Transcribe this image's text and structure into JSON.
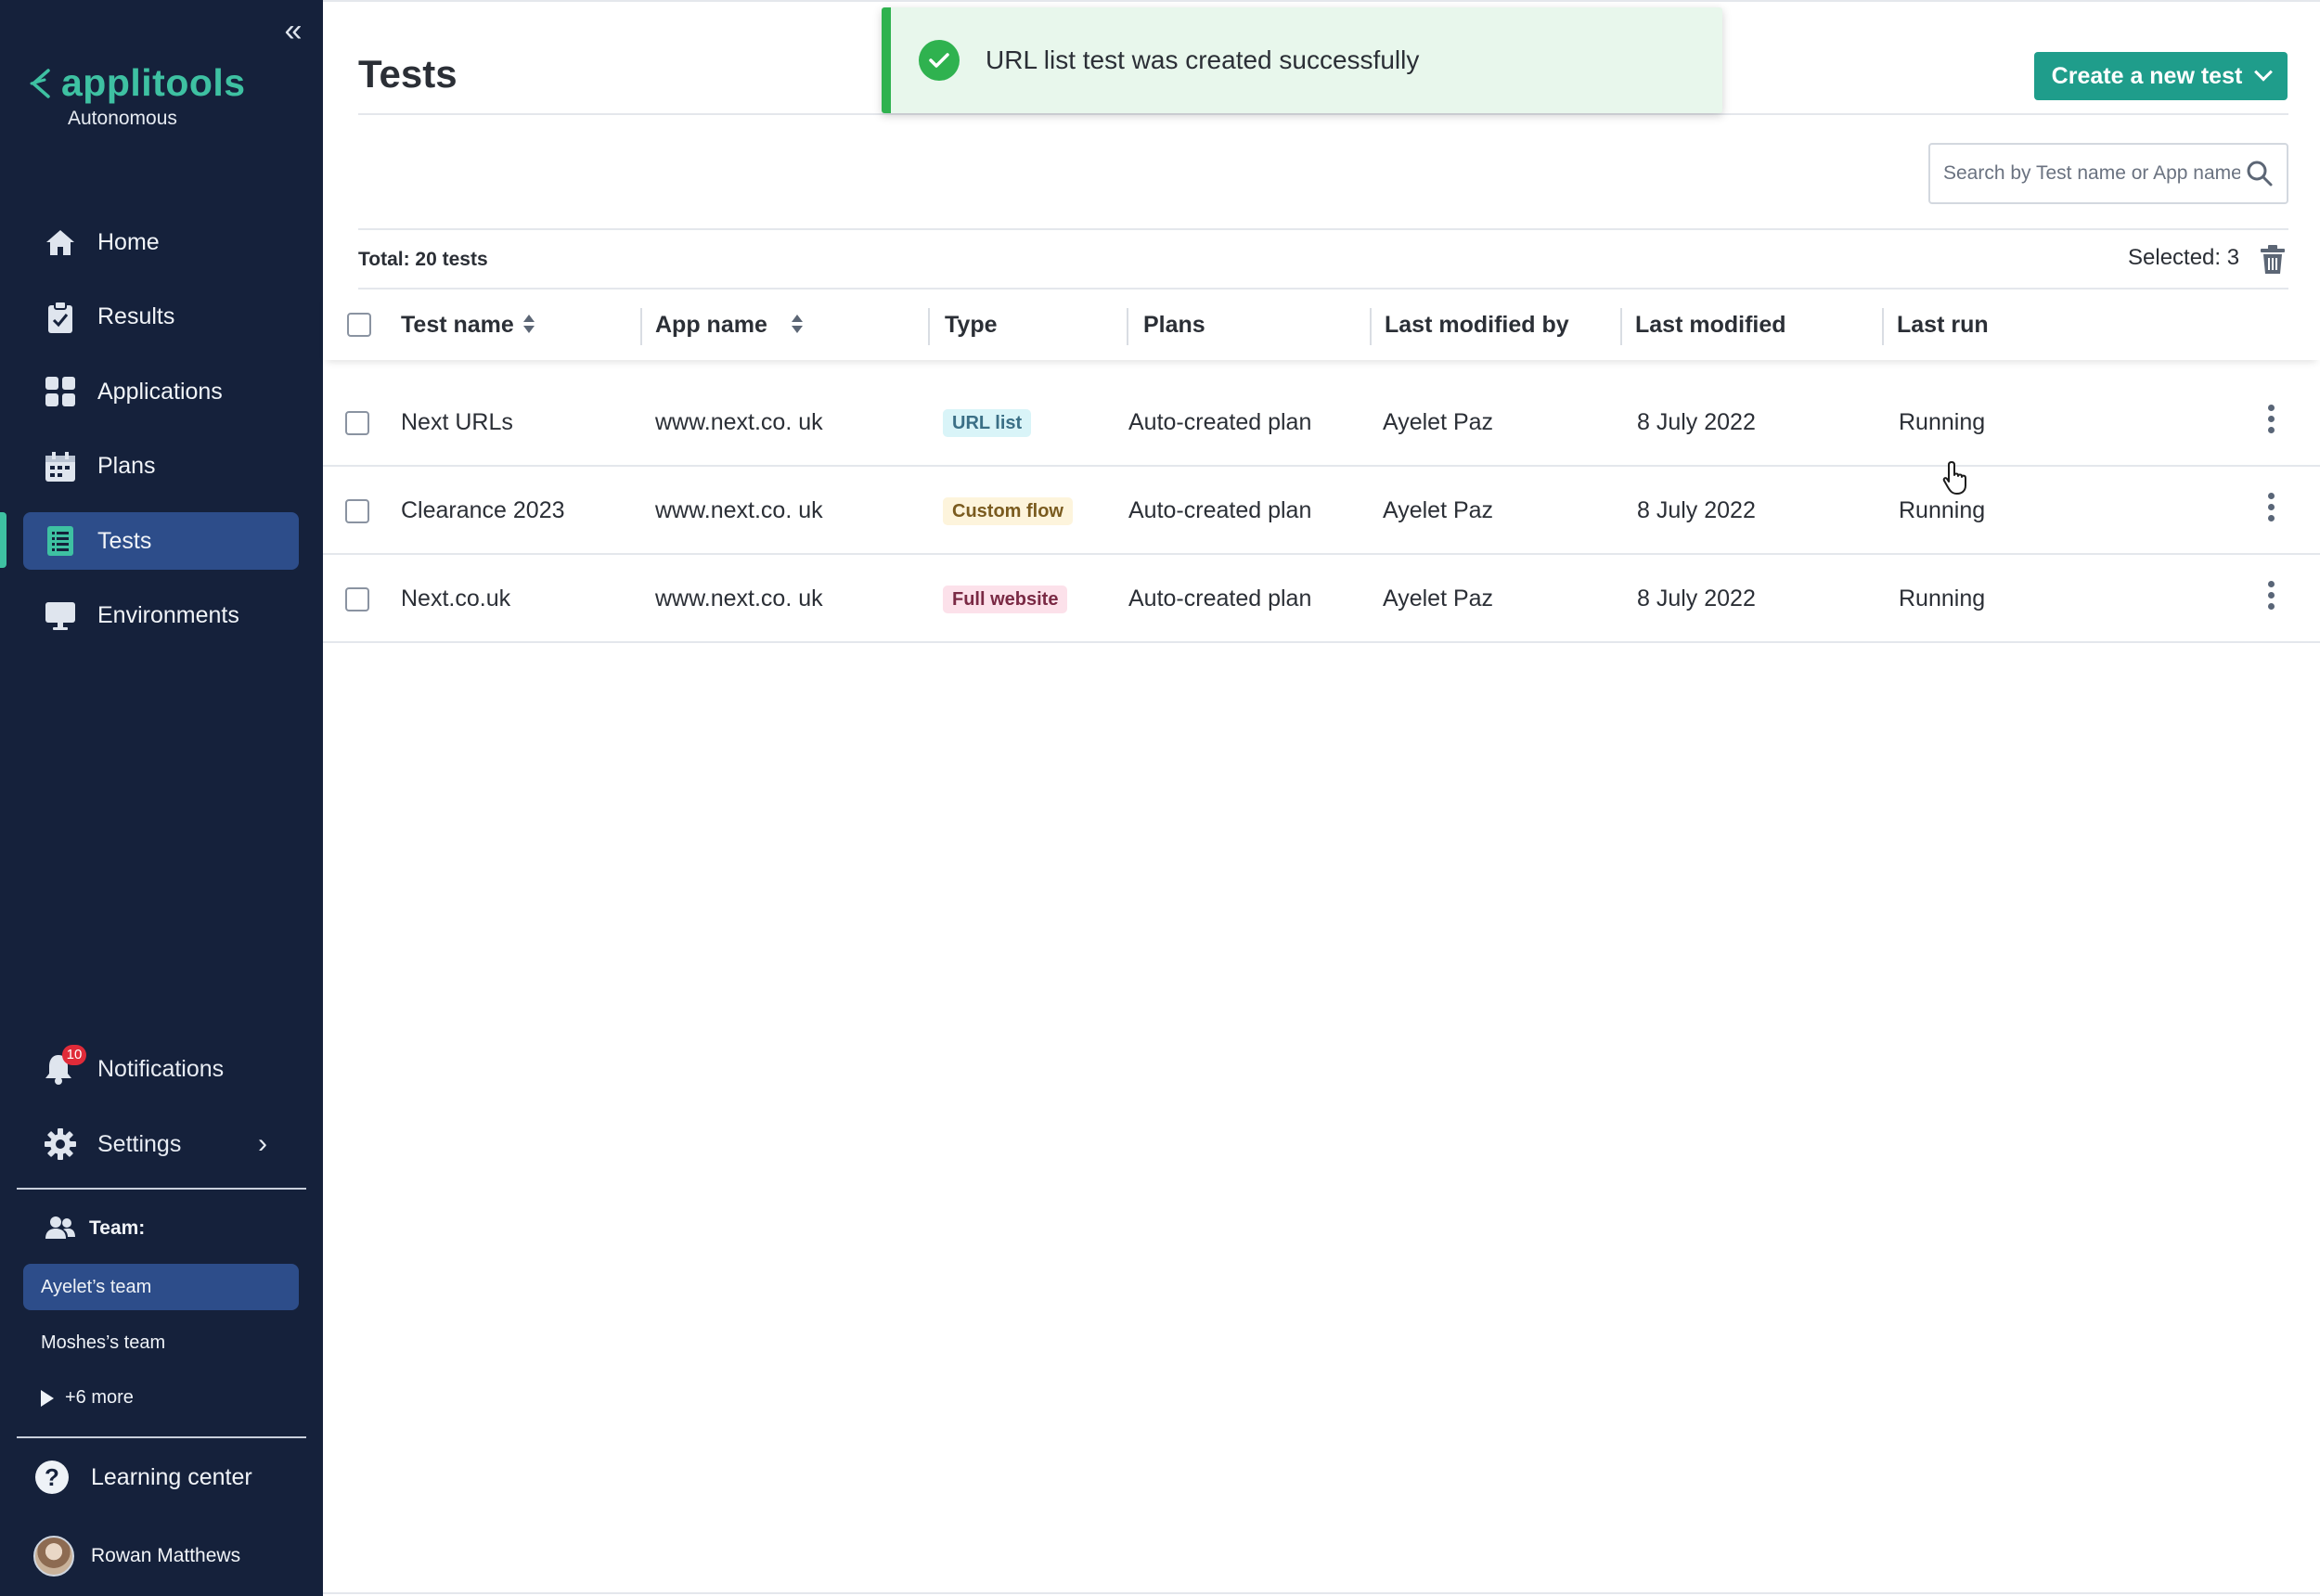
{
  "brand": {
    "name": "applitools",
    "subtitle": "Autonomous"
  },
  "sidebar": {
    "nav": [
      {
        "label": "Home",
        "icon": "home-icon"
      },
      {
        "label": "Results",
        "icon": "clipboard-check-icon"
      },
      {
        "label": "Applications",
        "icon": "grid-icon"
      },
      {
        "label": "Plans",
        "icon": "calendar-icon"
      },
      {
        "label": "Tests",
        "icon": "list-document-icon",
        "active": true
      },
      {
        "label": "Environments",
        "icon": "monitor-icon"
      }
    ],
    "notifications": {
      "label": "Notifications",
      "count": "10"
    },
    "settings": {
      "label": "Settings"
    },
    "team": {
      "label": "Team:",
      "teams": [
        "Ayelet’s team",
        "Moshes’s team"
      ],
      "more": "+6 more"
    },
    "learning_center": "Learning center",
    "user_name": "Rowan Matthews"
  },
  "page": {
    "title": "Tests",
    "create_button": "Create a new test",
    "search_placeholder": "Search by Test name or App name",
    "total": "Total: 20 tests",
    "selected": "Selected: 3"
  },
  "toast": {
    "message": "URL list test was created successfully"
  },
  "table": {
    "columns": [
      "Test name",
      "App name",
      "Type",
      "Plans",
      "Last modified by",
      "Last modified",
      "Last run"
    ],
    "rows": [
      {
        "test_name": "Next URLs",
        "app_name": "www.next.co. uk",
        "type": "URL list",
        "plan": "Auto-created plan",
        "modified_by": "Ayelet Paz",
        "modified": "8 July 2022",
        "last_run": "Running"
      },
      {
        "test_name": "Clearance 2023",
        "app_name": "www.next.co. uk",
        "type": "Custom flow",
        "plan": "Auto-created plan",
        "modified_by": "Ayelet Paz",
        "modified": "8 July 2022",
        "last_run": "Running"
      },
      {
        "test_name": "Next.co.uk",
        "app_name": "www.next.co. uk",
        "type": "Full website",
        "plan": "Auto-created plan",
        "modified_by": "Ayelet Paz",
        "modified": "8 July 2022",
        "last_run": "Running"
      }
    ]
  },
  "colors": {
    "sidebar_bg": "#15213b",
    "active_nav": "#2d4d8a",
    "brand_teal": "#3ec1a2",
    "button_teal": "#1f9d8b",
    "success_green": "#2fb24f",
    "tag_url_list": "#d9f4f8",
    "tag_custom_flow": "#fdf4dc",
    "tag_full_website": "#fce1ea"
  }
}
